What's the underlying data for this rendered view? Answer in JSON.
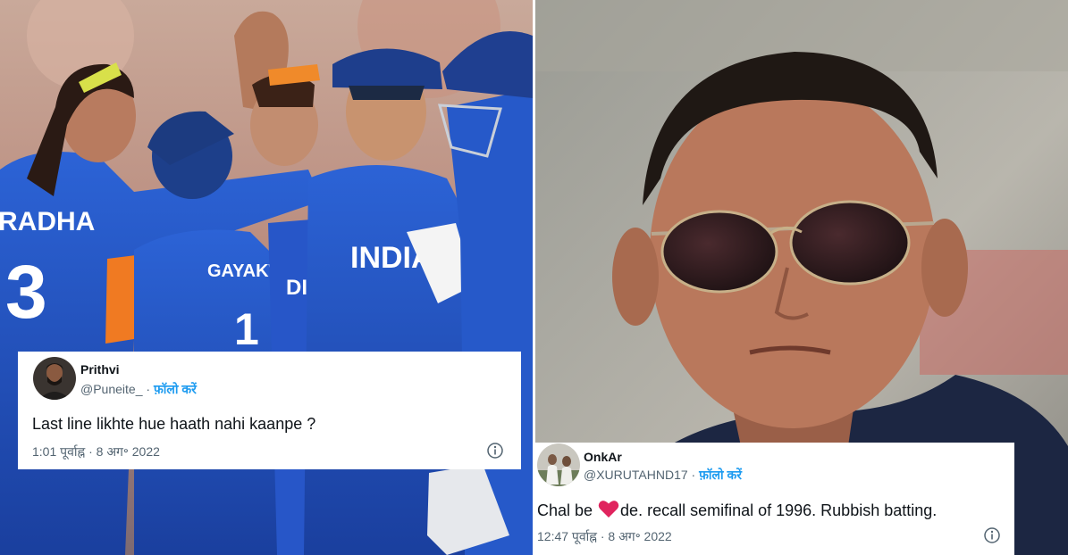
{
  "tweets": [
    {
      "name": "Prithvi",
      "handle": "@Puneite_",
      "separator": "·",
      "follow_label": "फ़ॉलो करें",
      "text": "Last line likhte hue haath nahi kaanpe ?",
      "timestamp": "1:01 पूर्वाह्न · 8 अग॰ 2022"
    },
    {
      "name": "OnkAr",
      "handle": "@XURUTAHND17",
      "separator": "·",
      "follow_label": "फ़ॉलो करें",
      "text_before": "Chal be ",
      "text_after": "de.  recall semifinal of 1996. Rubbish batting.",
      "timestamp": "12:47 पूर्वाह्न · 8 अग॰ 2022"
    }
  ],
  "photo_left": {
    "jersey_name_1": "RADHA",
    "jersey_number_1": "3",
    "jersey_name_2": "GAYAKWAD",
    "jersey_number_2": "1",
    "jersey_text_center": "INDIA",
    "jersey_text_partial": "DIA"
  },
  "icons": [
    "info-icon",
    "heart-icon"
  ],
  "colors": {
    "follow_blue": "#1d9bf0",
    "heart_red": "#e0245e",
    "jersey_blue": "#1f4fbf"
  }
}
